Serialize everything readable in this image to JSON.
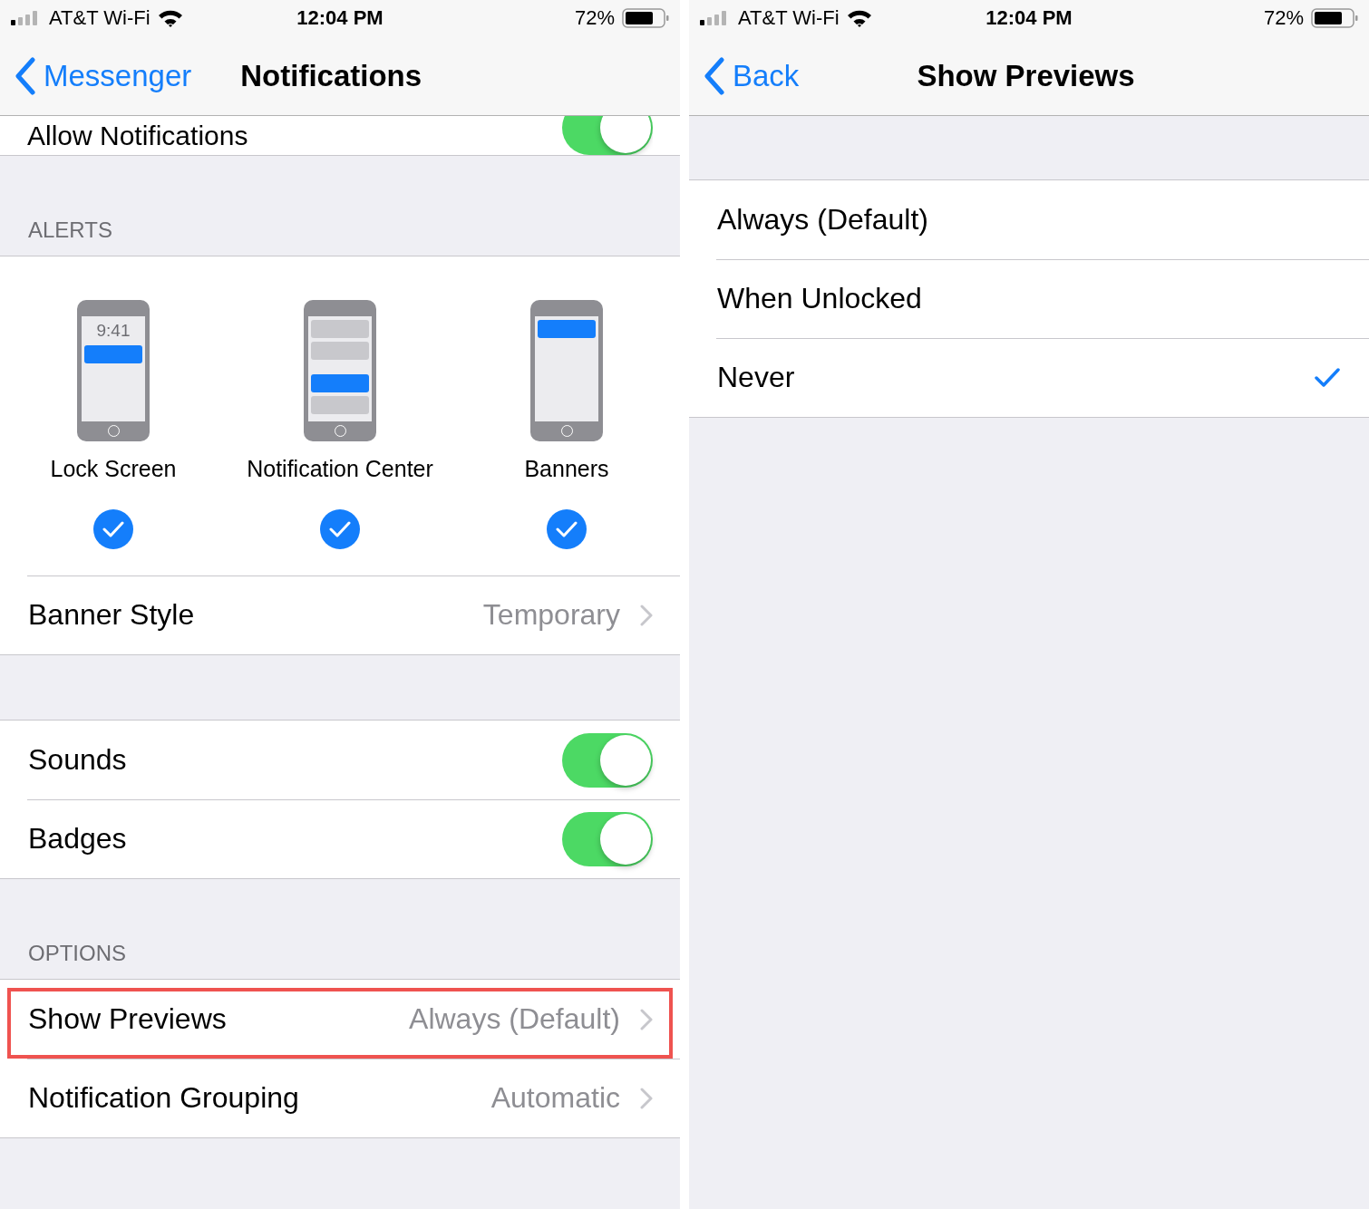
{
  "left_screen": {
    "status_bar": {
      "carrier": "AT&T Wi-Fi",
      "time": "12:04 PM",
      "battery": "72%"
    },
    "nav_bar": {
      "back": "Messenger",
      "title": "Notifications"
    },
    "allow_notifications": {
      "label": "Allow Notifications",
      "on": true
    },
    "alerts": {
      "header": "ALERTS",
      "styles": [
        {
          "kind": "lock",
          "clock": "9:41",
          "label": "Lock Screen",
          "selected": true
        },
        {
          "kind": "center",
          "label": "Notification Center",
          "selected": true
        },
        {
          "kind": "banners",
          "label": "Banners",
          "selected": true
        }
      ],
      "banner_style": {
        "label": "Banner Style",
        "value": "Temporary"
      }
    },
    "toggles": [
      {
        "label": "Sounds",
        "on": true
      },
      {
        "label": "Badges",
        "on": true
      }
    ],
    "options": {
      "header": "OPTIONS",
      "rows": [
        {
          "label": "Show Previews",
          "value": "Always (Default)",
          "highlighted": true
        },
        {
          "label": "Notification Grouping",
          "value": "Automatic",
          "highlighted": false
        }
      ]
    }
  },
  "right_screen": {
    "status_bar": {
      "carrier": "AT&T Wi-Fi",
      "time": "12:04 PM",
      "battery": "72%"
    },
    "nav_bar": {
      "back": "Back",
      "title": "Show Previews"
    },
    "choices": [
      {
        "label": "Always (Default)",
        "selected": false
      },
      {
        "label": "When Unlocked",
        "selected": false
      },
      {
        "label": "Never",
        "selected": true
      }
    ]
  }
}
